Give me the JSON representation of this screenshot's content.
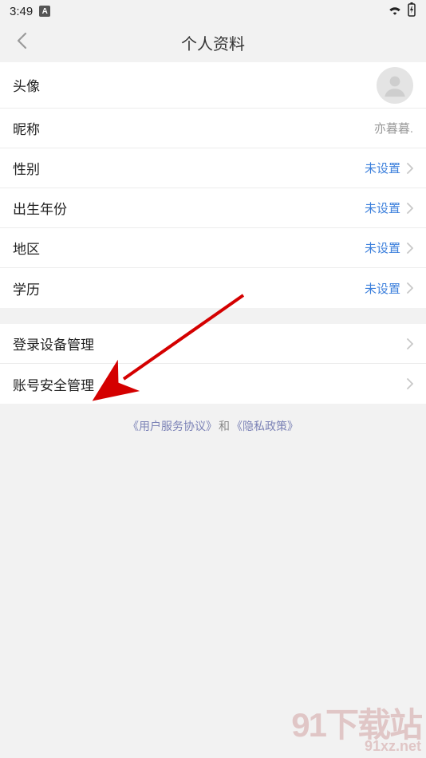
{
  "status": {
    "time": "3:49",
    "badge": "A"
  },
  "nav": {
    "title": "个人资料"
  },
  "section1": {
    "avatar_label": "头像",
    "nickname_label": "昵称",
    "nickname_value": "亦暮暮.",
    "gender_label": "性别",
    "gender_value": "未设置",
    "birth_label": "出生年份",
    "birth_value": "未设置",
    "region_label": "地区",
    "region_value": "未设置",
    "edu_label": "学历",
    "edu_value": "未设置"
  },
  "section2": {
    "devices_label": "登录设备管理",
    "security_label": "账号安全管理"
  },
  "footer": {
    "tos": "《用户服务协议》",
    "sep": "和",
    "privacy": "《隐私政策》"
  },
  "watermark": {
    "line1": "91下载站",
    "line2": "91xz.net"
  }
}
